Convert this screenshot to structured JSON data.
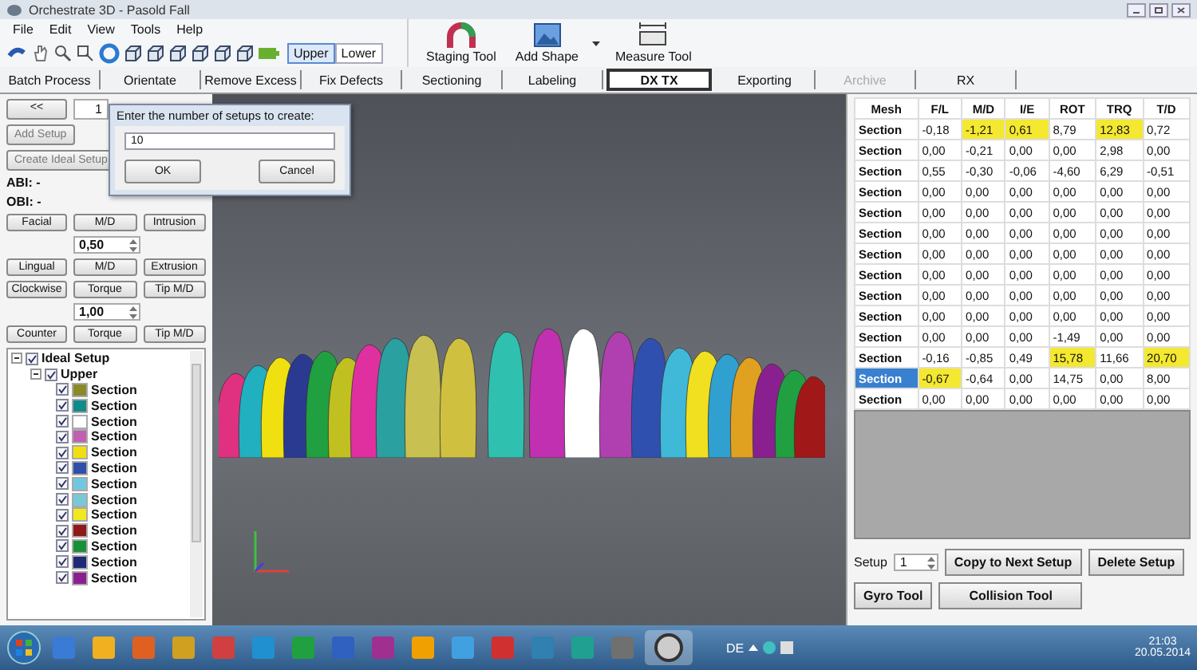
{
  "window": {
    "title": "Orchestrate 3D - Pasold Fall"
  },
  "menu": [
    "File",
    "Edit",
    "View",
    "Tools",
    "Help"
  ],
  "jaw_toggle": [
    {
      "label": "Upper",
      "selected": true
    },
    {
      "label": "Lower",
      "selected": false
    }
  ],
  "tools": [
    "Staging Tool",
    "Add Shape",
    "Measure Tool"
  ],
  "tabs": [
    {
      "label": "Batch Process",
      "selected": false,
      "disabled": false
    },
    {
      "label": "Orientate",
      "selected": false,
      "disabled": false
    },
    {
      "label": "Remove Excess",
      "selected": false,
      "disabled": false
    },
    {
      "label": "Fix Defects",
      "selected": false,
      "disabled": false
    },
    {
      "label": "Sectioning",
      "selected": false,
      "disabled": false
    },
    {
      "label": "Labeling",
      "selected": false,
      "disabled": false
    },
    {
      "label": "DX TX",
      "selected": true,
      "disabled": false
    },
    {
      "label": "Exporting",
      "selected": false,
      "disabled": false
    },
    {
      "label": "Archive",
      "selected": false,
      "disabled": true
    },
    {
      "label": "RX",
      "selected": false,
      "disabled": false
    }
  ],
  "left_panel": {
    "prev_button": "<<",
    "setup_field": "1",
    "add_setup": "Add Setup",
    "create_ideal_setup": "Create Ideal Setup",
    "abi": "ABI: -",
    "obi": "OBI: -",
    "button_rows": [
      [
        "Facial",
        "M/D",
        "Intrusion"
      ],
      [
        "Lingual",
        "M/D",
        "Extrusion"
      ],
      [
        "Clockwise",
        "Torque",
        "Tip M/D"
      ],
      [
        "Counter",
        "Torque",
        "Tip M/D"
      ]
    ],
    "step_fields": [
      "0,50",
      "1,00"
    ]
  },
  "tree": {
    "label": "Ideal Setup",
    "checked": true,
    "children": [
      {
        "label": "Upper",
        "checked": true,
        "children": [
          {
            "label": "Section",
            "checked": true,
            "color": "#8a8a2a"
          },
          {
            "label": "Section",
            "checked": true,
            "color": "#138a8a"
          },
          {
            "label": "Section",
            "checked": true,
            "color": "#ffffff"
          },
          {
            "label": "Section",
            "checked": true,
            "color": "#c060b0"
          },
          {
            "label": "Section",
            "checked": true,
            "color": "#f0e010"
          },
          {
            "label": "Section",
            "checked": true,
            "color": "#3050a8"
          },
          {
            "label": "Section",
            "checked": true,
            "color": "#70c8e0"
          },
          {
            "label": "Section",
            "checked": true,
            "color": "#78c8d8"
          },
          {
            "label": "Section",
            "checked": true,
            "color": "#f0e820"
          },
          {
            "label": "Section",
            "checked": true,
            "color": "#901818"
          },
          {
            "label": "Section",
            "checked": true,
            "color": "#189038"
          },
          {
            "label": "Section",
            "checked": true,
            "color": "#202878"
          },
          {
            "label": "Section",
            "checked": true,
            "color": "#8a2090"
          }
        ]
      }
    ]
  },
  "dialog": {
    "prompt": "Enter the number of setups to create:",
    "value": "10",
    "ok": "OK",
    "cancel": "Cancel"
  },
  "table": {
    "columns": [
      "Mesh",
      "F/L",
      "M/D",
      "I/E",
      "ROT",
      "TRQ",
      "T/D"
    ],
    "rows": [
      {
        "selected": false,
        "cells": [
          {
            "text": "Section",
            "highlighted": false
          },
          {
            "text": "-0,18",
            "highlighted": false
          },
          {
            "text": "-1,21",
            "highlighted": true
          },
          {
            "text": "0,61",
            "highlighted": true
          },
          {
            "text": "8,79",
            "highlighted": false
          },
          {
            "text": "12,83",
            "highlighted": true
          },
          {
            "text": "0,72",
            "highlighted": false
          }
        ]
      },
      {
        "selected": false,
        "cells": [
          {
            "text": "Section",
            "highlighted": false
          },
          {
            "text": "0,00",
            "highlighted": false
          },
          {
            "text": "-0,21",
            "highlighted": false
          },
          {
            "text": "0,00",
            "highlighted": false
          },
          {
            "text": "0,00",
            "highlighted": false
          },
          {
            "text": "2,98",
            "highlighted": false
          },
          {
            "text": "0,00",
            "highlighted": false
          }
        ]
      },
      {
        "selected": false,
        "cells": [
          {
            "text": "Section",
            "highlighted": false
          },
          {
            "text": "0,55",
            "highlighted": false
          },
          {
            "text": "-0,30",
            "highlighted": false
          },
          {
            "text": "-0,06",
            "highlighted": false
          },
          {
            "text": "-4,60",
            "highlighted": false
          },
          {
            "text": "6,29",
            "highlighted": false
          },
          {
            "text": "-0,51",
            "highlighted": false
          }
        ]
      },
      {
        "selected": false,
        "cells": [
          {
            "text": "Section",
            "highlighted": false
          },
          {
            "text": "0,00",
            "highlighted": false
          },
          {
            "text": "0,00",
            "highlighted": false
          },
          {
            "text": "0,00",
            "highlighted": false
          },
          {
            "text": "0,00",
            "highlighted": false
          },
          {
            "text": "0,00",
            "highlighted": false
          },
          {
            "text": "0,00",
            "highlighted": false
          }
        ]
      },
      {
        "selected": false,
        "cells": [
          {
            "text": "Section",
            "highlighted": false
          },
          {
            "text": "0,00",
            "highlighted": false
          },
          {
            "text": "0,00",
            "highlighted": false
          },
          {
            "text": "0,00",
            "highlighted": false
          },
          {
            "text": "0,00",
            "highlighted": false
          },
          {
            "text": "0,00",
            "highlighted": false
          },
          {
            "text": "0,00",
            "highlighted": false
          }
        ]
      },
      {
        "selected": false,
        "cells": [
          {
            "text": "Section",
            "highlighted": false
          },
          {
            "text": "0,00",
            "highlighted": false
          },
          {
            "text": "0,00",
            "highlighted": false
          },
          {
            "text": "0,00",
            "highlighted": false
          },
          {
            "text": "0,00",
            "highlighted": false
          },
          {
            "text": "0,00",
            "highlighted": false
          },
          {
            "text": "0,00",
            "highlighted": false
          }
        ]
      },
      {
        "selected": false,
        "cells": [
          {
            "text": "Section",
            "highlighted": false
          },
          {
            "text": "0,00",
            "highlighted": false
          },
          {
            "text": "0,00",
            "highlighted": false
          },
          {
            "text": "0,00",
            "highlighted": false
          },
          {
            "text": "0,00",
            "highlighted": false
          },
          {
            "text": "0,00",
            "highlighted": false
          },
          {
            "text": "0,00",
            "highlighted": false
          }
        ]
      },
      {
        "selected": false,
        "cells": [
          {
            "text": "Section",
            "highlighted": false
          },
          {
            "text": "0,00",
            "highlighted": false
          },
          {
            "text": "0,00",
            "highlighted": false
          },
          {
            "text": "0,00",
            "highlighted": false
          },
          {
            "text": "0,00",
            "highlighted": false
          },
          {
            "text": "0,00",
            "highlighted": false
          },
          {
            "text": "0,00",
            "highlighted": false
          }
        ]
      },
      {
        "selected": false,
        "cells": [
          {
            "text": "Section",
            "highlighted": false
          },
          {
            "text": "0,00",
            "highlighted": false
          },
          {
            "text": "0,00",
            "highlighted": false
          },
          {
            "text": "0,00",
            "highlighted": false
          },
          {
            "text": "0,00",
            "highlighted": false
          },
          {
            "text": "0,00",
            "highlighted": false
          },
          {
            "text": "0,00",
            "highlighted": false
          }
        ]
      },
      {
        "selected": false,
        "cells": [
          {
            "text": "Section",
            "highlighted": false
          },
          {
            "text": "0,00",
            "highlighted": false
          },
          {
            "text": "0,00",
            "highlighted": false
          },
          {
            "text": "0,00",
            "highlighted": false
          },
          {
            "text": "0,00",
            "highlighted": false
          },
          {
            "text": "0,00",
            "highlighted": false
          },
          {
            "text": "0,00",
            "highlighted": false
          }
        ]
      },
      {
        "selected": false,
        "cells": [
          {
            "text": "Section",
            "highlighted": false
          },
          {
            "text": "0,00",
            "highlighted": false
          },
          {
            "text": "0,00",
            "highlighted": false
          },
          {
            "text": "0,00",
            "highlighted": false
          },
          {
            "text": "-1,49",
            "highlighted": false
          },
          {
            "text": "0,00",
            "highlighted": false
          },
          {
            "text": "0,00",
            "highlighted": false
          }
        ]
      },
      {
        "selected": false,
        "cells": [
          {
            "text": "Section",
            "highlighted": false
          },
          {
            "text": "-0,16",
            "highlighted": false
          },
          {
            "text": "-0,85",
            "highlighted": false
          },
          {
            "text": "0,49",
            "highlighted": false
          },
          {
            "text": "15,78",
            "highlighted": true
          },
          {
            "text": "11,66",
            "highlighted": false
          },
          {
            "text": "20,70",
            "highlighted": true
          }
        ]
      },
      {
        "selected": true,
        "cells": [
          {
            "text": "Section",
            "highlighted": false
          },
          {
            "text": "-0,67",
            "highlighted": true
          },
          {
            "text": "-0,64",
            "highlighted": false
          },
          {
            "text": "0,00",
            "highlighted": false
          },
          {
            "text": "14,75",
            "highlighted": false
          },
          {
            "text": "0,00",
            "highlighted": false
          },
          {
            "text": "8,00",
            "highlighted": false
          }
        ]
      },
      {
        "selected": false,
        "cells": [
          {
            "text": "Section",
            "highlighted": false
          },
          {
            "text": "0,00",
            "highlighted": false
          },
          {
            "text": "0,00",
            "highlighted": false
          },
          {
            "text": "0,00",
            "highlighted": false
          },
          {
            "text": "0,00",
            "highlighted": false
          },
          {
            "text": "0,00",
            "highlighted": false
          },
          {
            "text": "0,00",
            "highlighted": false
          }
        ]
      }
    ]
  },
  "setup_controls": {
    "label": "Setup",
    "value": "1",
    "buttons": [
      "Copy to Next Setup",
      "Delete Setup",
      "Gyro Tool",
      "Collision Tool"
    ]
  },
  "taskbar": {
    "language": "DE",
    "time": "21:03",
    "date": "20.05.2014"
  }
}
